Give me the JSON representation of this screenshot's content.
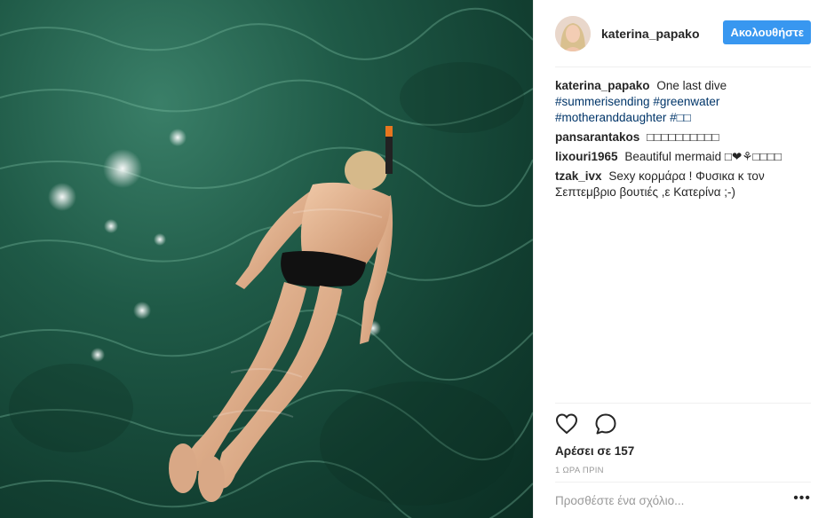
{
  "header": {
    "username": "katerina_papako",
    "follow_label": "Ακολουθήστε"
  },
  "photo": {
    "alt": "Woman snorkeling in green water"
  },
  "caption": {
    "author": "katerina_papako",
    "text": "One last dive",
    "hashtags": [
      "#summerisending",
      "#greenwater",
      "#motheranddaughter",
      "#□□"
    ]
  },
  "comments": [
    {
      "author": "pansarantakos",
      "text": "□□□□□□□□□□"
    },
    {
      "author": "lixouri1965",
      "text": "Beautiful mermaid □❤⚘□□□□"
    },
    {
      "author": "tzak_ivx",
      "text": "Sexy κορμάρα ! Φυσικα κ τον Σεπτεμβριο βουτιές ,ε Κατερίνα ;-)"
    }
  ],
  "actions": {
    "like_icon": "heart-icon",
    "comment_icon": "speech-bubble-icon",
    "likes_text": "Αρέσει σε 157",
    "time_text": "1 ΩΡΑ ΠΡΙΝ"
  },
  "add_comment": {
    "placeholder": "Προσθέστε ένα σχόλιο...",
    "more_label": "•••"
  },
  "colors": {
    "accent": "#3897f0",
    "hashtag": "#003569",
    "muted": "#999999",
    "water": "#1f5a47"
  }
}
